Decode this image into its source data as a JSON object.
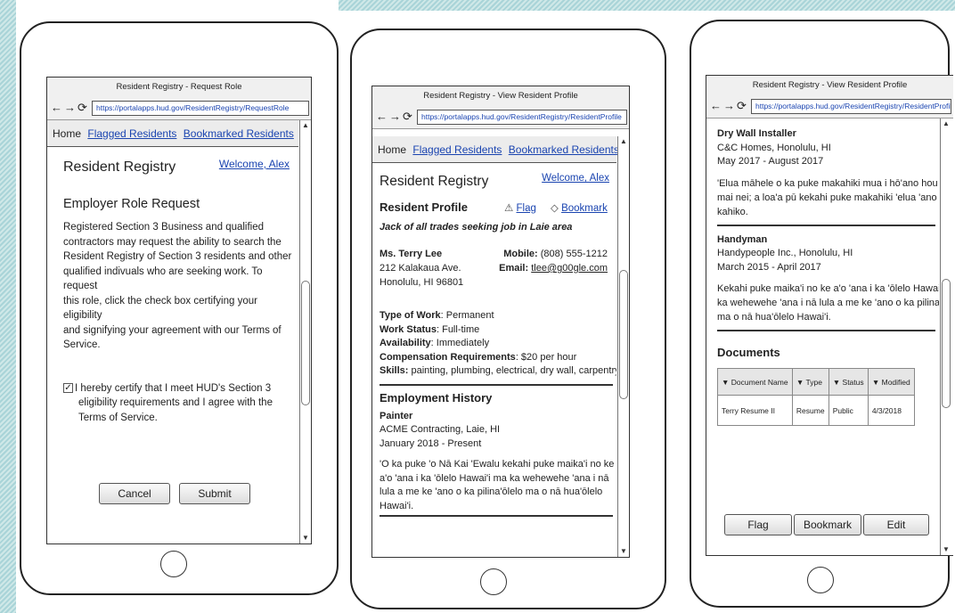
{
  "colors": {
    "link": "#1a44b0",
    "accent_hatch": "#a9d4d8"
  },
  "nav_icons": [
    "back-arrow-icon",
    "forward-arrow-icon",
    "refresh-icon"
  ],
  "screen1": {
    "window_title": "Resident Registry - Request Role",
    "url": "https://portalapps.hud.gov/ResidentRegistry/RequestRole",
    "nav": {
      "home": "Home",
      "flagged": "Flagged Residents",
      "bookmarked": "Bookmarked Residents"
    },
    "app_title": "Resident Registry",
    "welcome": "Welcome, Alex",
    "heading": "Employer Role Request",
    "body_lines": [
      "Registered Section 3 Business and qualified",
      "contractors may request the ability to search the",
      "Resident Registry of Section 3 residents and other",
      "qualified indivuals who are seeking work. To request",
      "this role, click the check box certifying your eligibility",
      "and signifying your agreement with our Terms of",
      "Service."
    ],
    "certify_checked": true,
    "certify_lines": [
      "I hereby certify that I meet HUD's Section 3",
      "eligibility requirements and I agree with the",
      "Terms of Service."
    ],
    "cancel": "Cancel",
    "submit": "Submit"
  },
  "screen2": {
    "window_title": "Resident Registry - View Resident Profile",
    "url": "https://portalapps.hud.gov/ResidentRegistry/ResidentProfile",
    "nav": {
      "home": "Home",
      "flagged": "Flagged Residents",
      "bookmarked": "Bookmarked Residents"
    },
    "app_title": "Resident Registry",
    "welcome": "Welcome, Alex",
    "profile_heading": "Resident Profile",
    "flag": "Flag",
    "bookmark": "Bookmark",
    "tagline": "Jack of all trades seeking job in Laie area",
    "name": "Ms. Terry Lee",
    "address1": "212 Kalakaua Ave.",
    "address2": "Honolulu, HI 96801",
    "mobile_label": "Mobile:",
    "mobile": "(808) 555-1212",
    "email_label": "Email:",
    "email": "tlee@g00gle.com",
    "type_label": "Type of Work",
    "type_value": ": Permanent",
    "status_label": "Work Status",
    "status_value": ": Full-time",
    "avail_label": "Availability",
    "avail_value": ": Immediately",
    "comp_label": "Compensation Requirements",
    "comp_value": ": $20 per hour",
    "skills_label": "Skills:",
    "skills_value": " painting, plumbing, electrical, dry wall, carpentry",
    "history_heading": "Employment History",
    "job_title": "Painter",
    "job_company": "ACME Contracting, Laie, HI",
    "job_dates": "January 2018 - Present",
    "job_desc_lines": [
      "'O ka puke 'o Nā Kai 'Ewalu kekahi puke maika'i no ke",
      "a'o 'ana i ka 'ōlelo Hawai'i ma ka wehewehe 'ana i nā",
      "lula a me ke 'ano o ka pilina'ōlelo ma o nā hua'ōlelo",
      "Hawai'i."
    ]
  },
  "screen3": {
    "window_title": "Resident Registry - View Resident Profile",
    "url": "https://portalapps.hud.gov/ResidentRegistry/ResidentProfile",
    "job1_title": "Dry Wall Installer",
    "job1_company": "C&C Homes, Honolulu, HI",
    "job1_dates": "May 2017 - August 2017",
    "job1_desc_lines": [
      "'Elua māhele o ka puke makahiki mua i hō'ano hou 'ia",
      "mai nei; a loa'a pū kekahi puke makahiki 'elua 'ano",
      "kahiko."
    ],
    "job2_title": "Handyman",
    "job2_company": "Handypeople Inc., Honolulu, HI",
    "job2_dates": "March 2015 - April 2017",
    "job2_desc_lines": [
      "Kekahi puke maika'i no ke a'o 'ana i ka 'ōlelo Hawai'i ma",
      "ka wehewehe 'ana i nā lula a me ke 'ano o ka pilina'ōlelo",
      "ma o nā hua'ōlelo Hawai'i."
    ],
    "documents_heading": "Documents",
    "table_headers": [
      "Document Name",
      "Type",
      "Status",
      "Modified"
    ],
    "table_rows": [
      [
        "Terry Resume II",
        "Resume",
        "Public",
        "4/3/2018"
      ]
    ],
    "flag_btn": "Flag",
    "bookmark_btn": "Bookmark",
    "edit_btn": "Edit"
  }
}
